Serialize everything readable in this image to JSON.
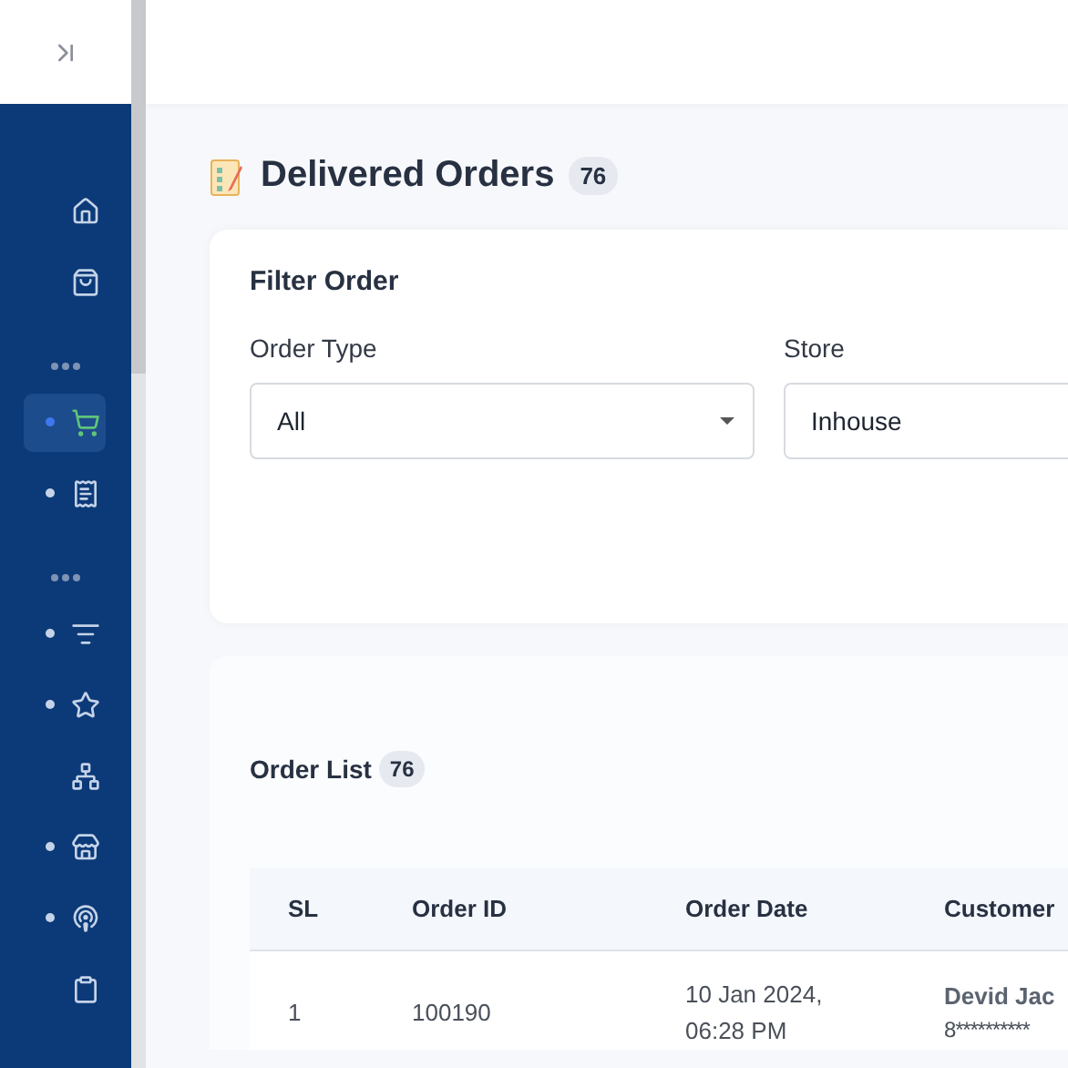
{
  "sidebar": {
    "items": [
      {
        "kind": "item",
        "bullet": false,
        "selected": false
      },
      {
        "kind": "item",
        "bullet": false,
        "selected": false
      },
      {
        "kind": "section"
      },
      {
        "kind": "item",
        "bullet": true,
        "selected": true
      },
      {
        "kind": "item",
        "bullet": true,
        "selected": false
      },
      {
        "kind": "section"
      },
      {
        "kind": "item",
        "bullet": true,
        "selected": false
      },
      {
        "kind": "item",
        "bullet": true,
        "selected": false
      },
      {
        "kind": "item",
        "bullet": false,
        "selected": false
      },
      {
        "kind": "item",
        "bullet": true,
        "selected": false
      },
      {
        "kind": "item",
        "bullet": true,
        "selected": false
      },
      {
        "kind": "item",
        "bullet": false,
        "selected": false
      }
    ]
  },
  "page": {
    "title": "Delivered Orders",
    "count": "76"
  },
  "filter": {
    "title": "Filter Order",
    "fields": [
      {
        "label": "Order Type",
        "value": "All",
        "dropdown": true
      },
      {
        "label": "Store",
        "value": "Inhouse",
        "dropdown": false
      }
    ]
  },
  "order_list": {
    "title": "Order List",
    "count": "76",
    "columns": [
      "SL",
      "Order ID",
      "Order Date",
      "Customer"
    ],
    "rows": [
      {
        "sl": "1",
        "order_id": "100190",
        "date": "10 Jan 2024,",
        "time": "06:28 PM",
        "customer": "Devid Jac",
        "phone": "8**********"
      }
    ]
  }
}
